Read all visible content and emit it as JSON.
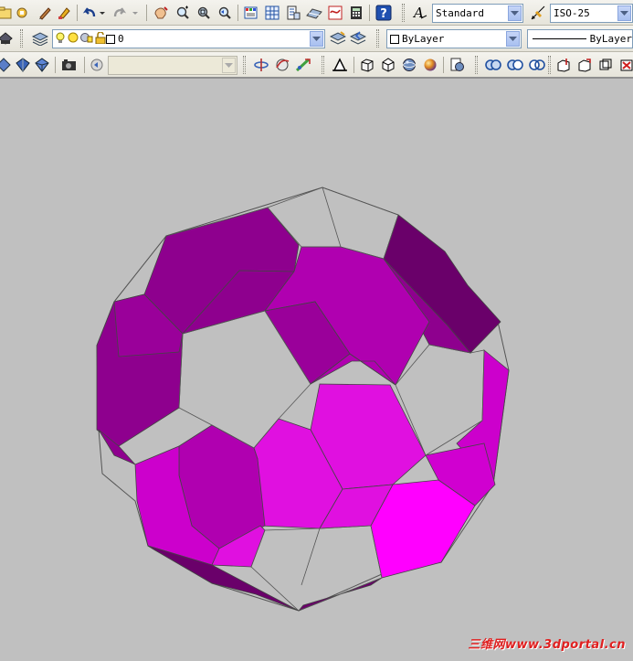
{
  "toolbar": {
    "text_style": "Standard",
    "dim_style": "ISO-25",
    "layer": "0",
    "color": "ByLayer",
    "linetype": "ByLayer"
  },
  "icons": [
    "open-icon",
    "publish-icon",
    "match-properties-icon",
    "brush-icon",
    "undo-icon",
    "redo-icon",
    "pan-icon",
    "zoom-realtime-icon",
    "zoom-window-icon",
    "zoom-previous-icon",
    "properties-icon",
    "design-center-icon",
    "tool-palettes-icon",
    "markup-icon",
    "calculator-icon",
    "help-icon",
    "text-style-icon",
    "dim-style-icon",
    "layer-manager-icon",
    "layer-previous-icon",
    "layer-state-icons",
    "shade-icons",
    "camera-icon",
    "orbit-icon",
    "free-orbit-icon",
    "continuous-orbit-icon",
    "ucs-icon",
    "box-icon",
    "wedge-icon",
    "sphere-icon",
    "render-icon",
    "solid-edit-icons",
    "3d-view-icons"
  ],
  "viewport": {
    "background": "#c0c0c0",
    "model": "truncated-icosahedron",
    "face_colors": [
      "#8e008e",
      "#b000b0",
      "#e010e0",
      "#ff00ff",
      "#6a006a"
    ]
  },
  "watermark": "三维网www.3dportal.cn"
}
